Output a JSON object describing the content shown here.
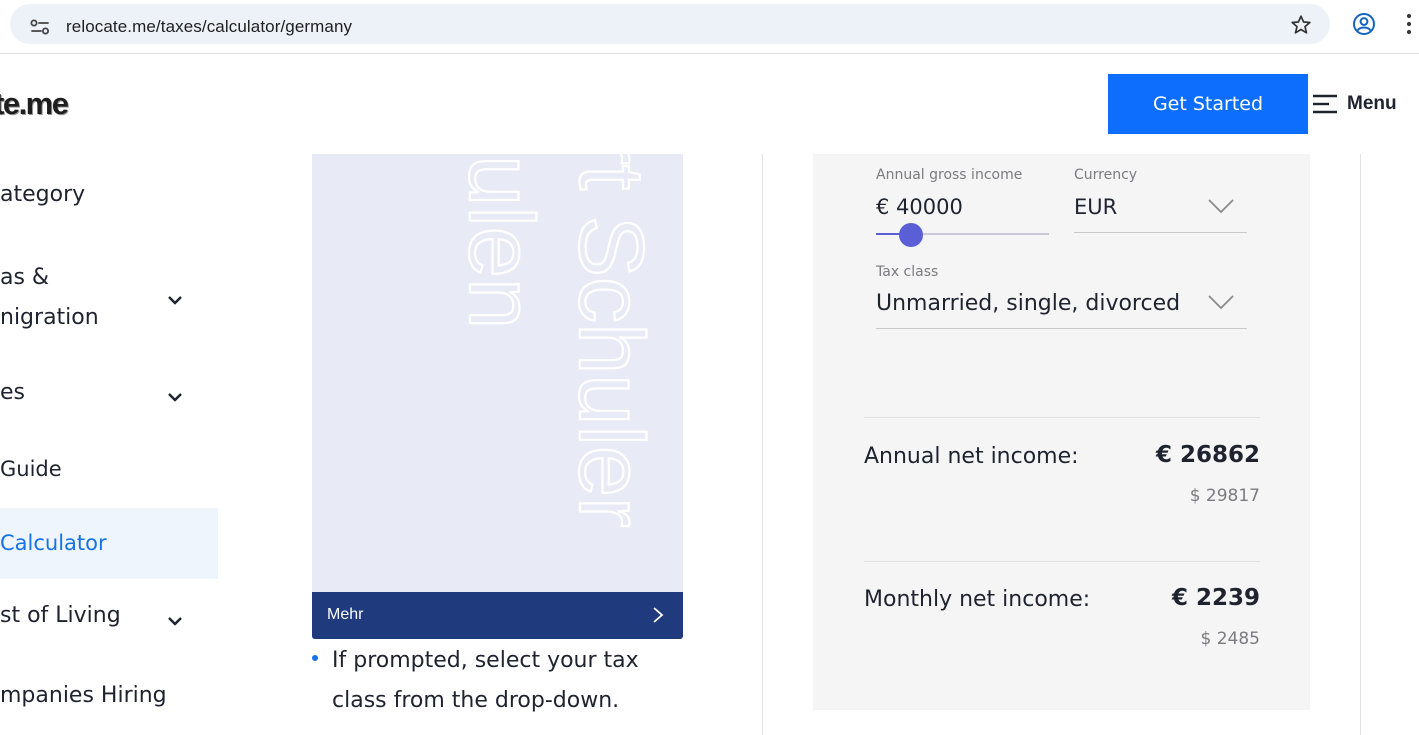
{
  "browser": {
    "url": "relocate.me/taxes/calculator/germany",
    "icons": [
      "site-info-icon",
      "star-icon",
      "profile-icon",
      "more-vert-icon"
    ]
  },
  "header": {
    "logo_text": "te.me",
    "cta_label": "Get Started",
    "menu_label": "Menu"
  },
  "sidebar": {
    "items": [
      {
        "label": "ategory",
        "label2": "",
        "has_chevron": false,
        "active": false
      },
      {
        "label": "as &",
        "label2": "nigration",
        "has_chevron": true,
        "active": false
      },
      {
        "label": "es",
        "label2": "",
        "has_chevron": true,
        "active": false
      },
      {
        "label": " Guide",
        "label2": "",
        "has_chevron": false,
        "active": false
      },
      {
        "label": " Calculator",
        "label2": "",
        "has_chevron": false,
        "active": true
      },
      {
        "label": "st of Living",
        "label2": "",
        "has_chevron": true,
        "active": false
      },
      {
        "label": "mpanies Hiring",
        "label2": "",
        "has_chevron": false,
        "active": false
      }
    ]
  },
  "ad": {
    "art_text_1": "rt Schuler",
    "art_text_2": "hulen",
    "footer_label": "Mehr"
  },
  "instructions": {
    "bullet_text": "If prompted, select your tax class from the drop-down."
  },
  "calculator": {
    "income_label": "Annual gross income",
    "income_value": "€ 40000",
    "income_slider_fraction": 0.2,
    "currency_label": "Currency",
    "currency_value": "EUR",
    "taxclass_label": "Tax class",
    "taxclass_value": "Unmarried, single, divorced",
    "annual_label": "Annual net income:",
    "annual_value": "€ 26862",
    "annual_usd": "$ 29817",
    "monthly_label": "Monthly net income:",
    "monthly_value": "€ 2239",
    "monthly_usd": "$ 2485"
  },
  "colors": {
    "accent": "#0d6efd",
    "link_active": "#1573e6",
    "slider": "#5a5fd6",
    "ad_footer": "#1f3a7d"
  }
}
